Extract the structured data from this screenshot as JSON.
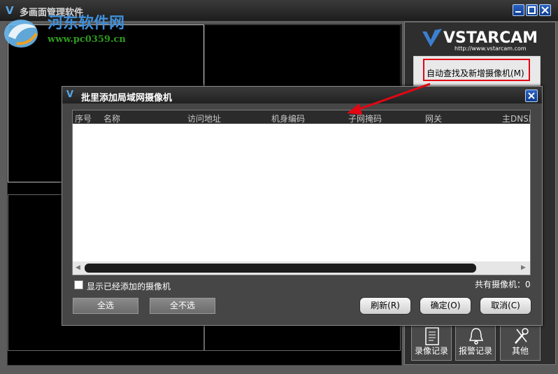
{
  "window": {
    "title": "多画面管理软件"
  },
  "watermark": {
    "site_name": "河东软件网",
    "url": "www.pc0359.cn"
  },
  "brand": {
    "name": "VSTARCAM",
    "url": "http://www.vstarcam.com"
  },
  "side_panel": {
    "auto_find_button": "自动查找及新增摄像机(M)",
    "tools": [
      {
        "label": "录像记录",
        "icon": "recording-record-icon"
      },
      {
        "label": "报警记录",
        "icon": "alarm-bell-icon"
      },
      {
        "label": "其他",
        "icon": "tools-icon"
      }
    ]
  },
  "dialog": {
    "title": "批里添加局域网摄像机",
    "columns": [
      "序号",
      "名称",
      "访问地址",
      "机身编码",
      "子网掩码",
      "网关",
      "主DNS服"
    ],
    "show_added_label": "显示已经添加的摄像机",
    "show_added_checked": false,
    "total_label": "共有摄像机：0",
    "buttons": {
      "select_all": "全选",
      "select_none": "全不选",
      "refresh": "刷新(R)",
      "ok": "确定(O)",
      "cancel": "取消(C)"
    }
  },
  "colors": {
    "highlight_outline": "#e30613",
    "title_button_blue": "#1f56b0",
    "watermark_blue": "#3f8fd9",
    "watermark_green": "#2f9a1f"
  }
}
